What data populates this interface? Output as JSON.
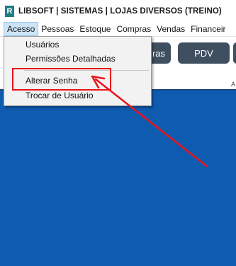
{
  "window": {
    "logo_letter": "R",
    "title": "LIBSOFT | SISTEMAS | LOJAS DIVERSOS (TREINO)"
  },
  "menubar": {
    "items": [
      "Acesso",
      "Pessoas",
      "Estoque",
      "Compras",
      "Vendas",
      "Financeir"
    ],
    "active_index": 0
  },
  "toolbar": {
    "buttons": [
      "ras",
      "PDV"
    ],
    "corner_mark": "A"
  },
  "dropdown": {
    "items": [
      "Usuários",
      "Permissões Detalhadas",
      "Alterar Senha",
      "Trocar de Usuário"
    ],
    "highlighted_index": 2
  },
  "colors": {
    "desktop_background": "#0f5bb0",
    "toolbar_button": "#3f4f60",
    "annotation_red": "#e8141b",
    "menu_active": "#cce4f7"
  }
}
